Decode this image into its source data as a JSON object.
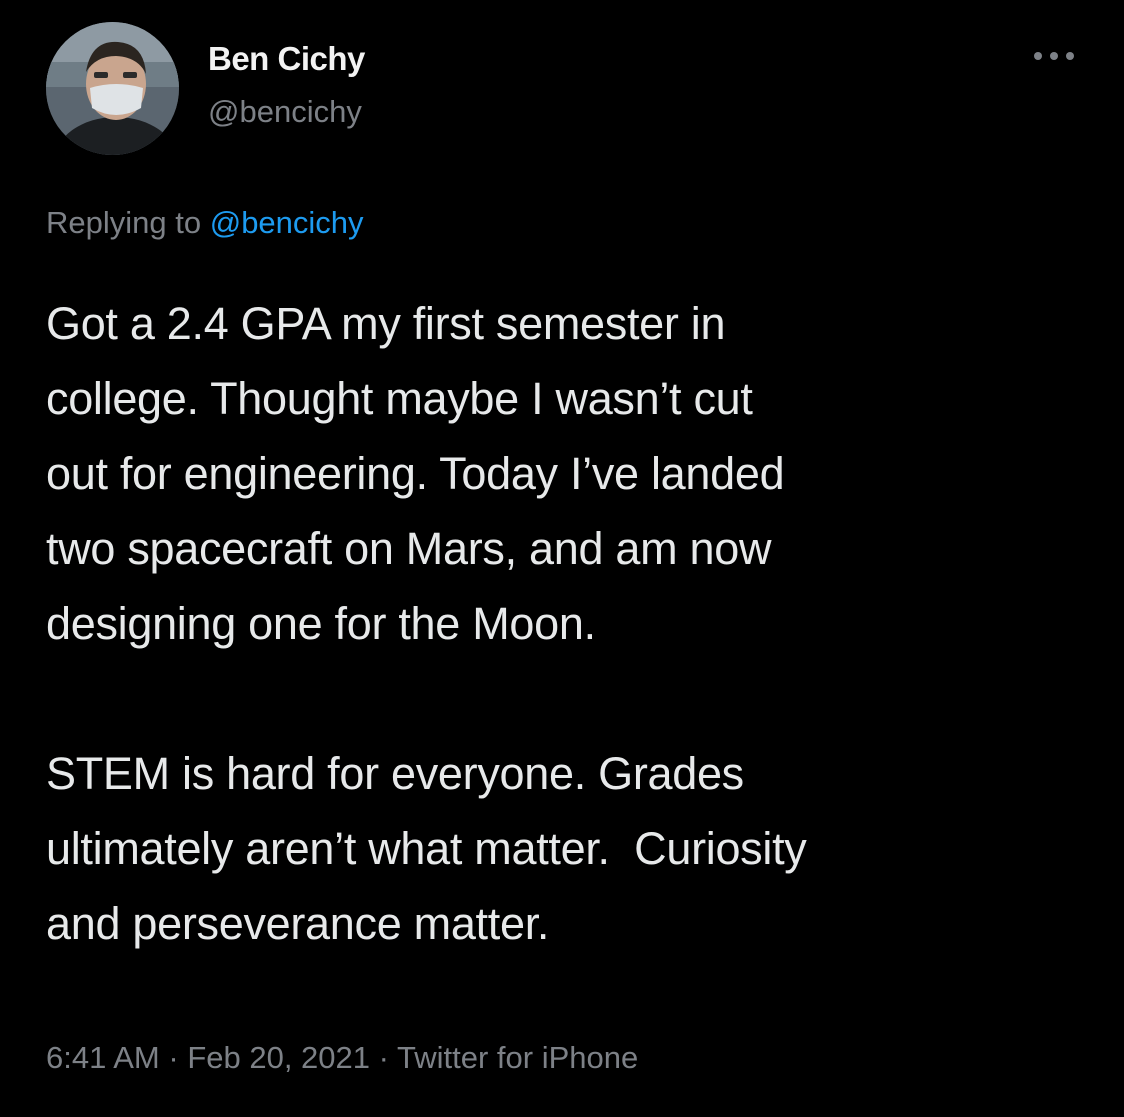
{
  "author": {
    "name": "Ben Cichy",
    "handle": "@bencichy"
  },
  "reply": {
    "prefix": "Replying to ",
    "mention": "@bencichy"
  },
  "tweet": {
    "text": "Got a 2.4 GPA my first semester in\ncollege. Thought maybe I wasn’t cut\nout for engineering. Today I’ve landed\ntwo spacecraft on Mars, and am now\ndesigning one for the Moon.\n\nSTEM is hard for everyone. Grades\nultimately aren’t what matter.  Curiosity\nand perseverance matter.",
    "time": "6:41 AM",
    "separator": " · ",
    "date": "Feb 20, 2021",
    "source": "Twitter for iPhone"
  },
  "icons": {
    "more": "more-icon",
    "avatar": "avatar"
  },
  "colors": {
    "background": "#000000",
    "text": "#e7e9ea",
    "secondary": "#7d8187",
    "accent": "#1d9bf0"
  }
}
